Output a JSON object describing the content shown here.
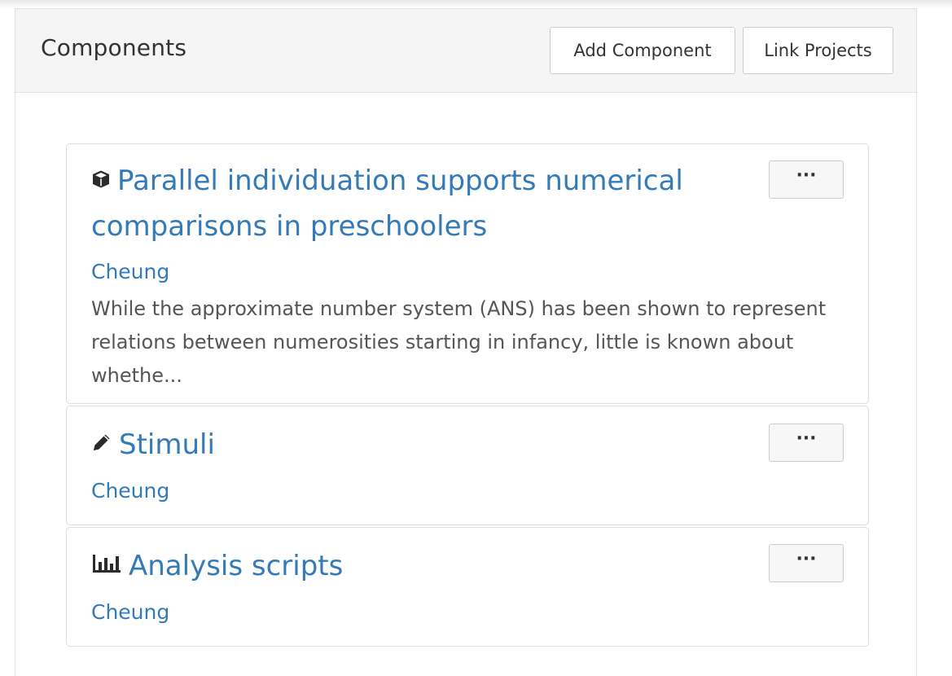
{
  "panel": {
    "title": "Components",
    "add_component_label": "Add Component",
    "link_projects_label": "Link Projects"
  },
  "components": [
    {
      "icon": "cube-icon",
      "title": "Parallel individuation supports numerical comparisons in preschoolers",
      "contributor": "Cheung",
      "description": "While the approximate number system (ANS) has been shown to represent relations between numerosities starting in infancy, little is known about whethe...",
      "menu_label": "···"
    },
    {
      "icon": "pencil-icon",
      "title": "Stimuli",
      "contributor": "Cheung",
      "menu_label": "···"
    },
    {
      "icon": "bar-chart-icon",
      "title": "Analysis scripts",
      "contributor": "Cheung",
      "menu_label": "···"
    }
  ]
}
